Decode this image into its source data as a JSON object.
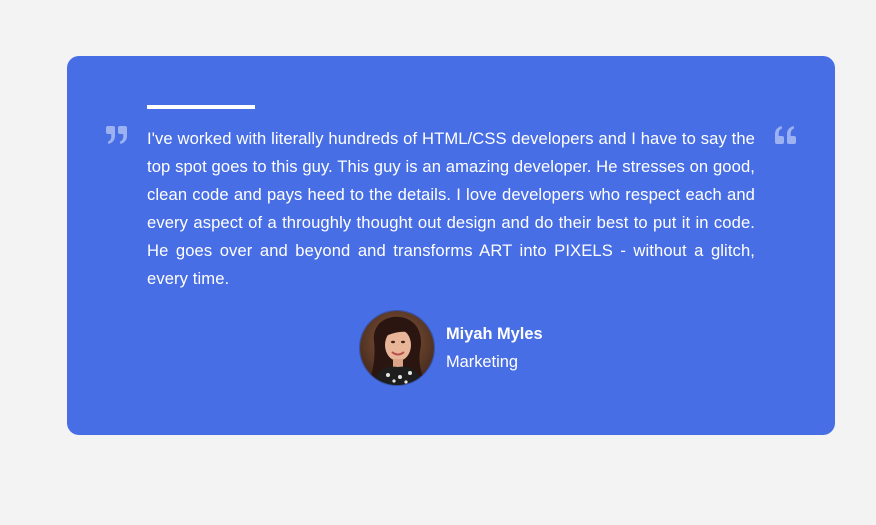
{
  "testimonial": {
    "text": "I've worked with literally hundreds of HTML/CSS developers and I have to say the top spot goes to this guy. This guy is an amazing developer. He stresses on good, clean code and pays heed to the details. I love developers who respect each and every aspect of a throughly thought out design and do their best to put it in code. He goes over and beyond and transforms ART into PIXELS - without a glitch, every time.",
    "author_name": "Miyah Myles",
    "author_role": "Marketing"
  },
  "icons": {
    "left_quote": "quote-close-icon",
    "right_quote": "quote-open-icon"
  },
  "colors": {
    "background": "#f3f3f3",
    "card": "#486ee5",
    "quote_icon": "#9db2f0",
    "text": "#ffffff"
  }
}
